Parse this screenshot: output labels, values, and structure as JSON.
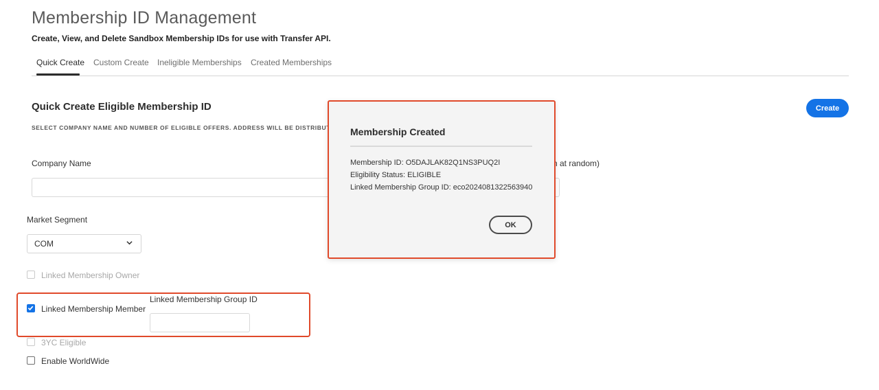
{
  "header": {
    "title": "Membership ID Management",
    "subtitle": "Create, View, and Delete Sandbox Membership IDs for use with Transfer API."
  },
  "tabs": [
    {
      "label": "Quick Create",
      "active": true
    },
    {
      "label": "Custom Create",
      "active": false
    },
    {
      "label": "Ineligible Memberships",
      "active": false
    },
    {
      "label": "Created Memberships",
      "active": false
    }
  ],
  "section": {
    "title": "Quick Create Eligible Membership ID",
    "instructions": "SELECT COMPANY NAME AND NUMBER OF ELIGIBLE OFFERS. ADDRESS WILL BE DISTRIBUTOR",
    "create_label": "Create",
    "right_hint": "n at random)"
  },
  "form": {
    "company_name_label": "Company Name",
    "company_name_value": "",
    "market_segment_label": "Market Segment",
    "market_segment_value": "COM",
    "linked_owner_label": "Linked Membership Owner",
    "linked_member_label": "Linked Membership Member",
    "linked_group_id_label": "Linked Membership Group ID",
    "linked_group_id_value": "",
    "three_yc_label": "3YC Eligible",
    "worldwide_label": "Enable WorldWide"
  },
  "modal": {
    "title": "Membership Created",
    "membership_id": "Membership ID: O5DAJLAK82Q1NS3PUQ2I",
    "eligibility": "Eligibility Status: ELIGIBLE",
    "group_id": "Linked Membership Group ID: eco2024081322563940",
    "ok_label": "OK"
  },
  "colors": {
    "accent": "#1473e6",
    "highlight": "#e0492a"
  }
}
